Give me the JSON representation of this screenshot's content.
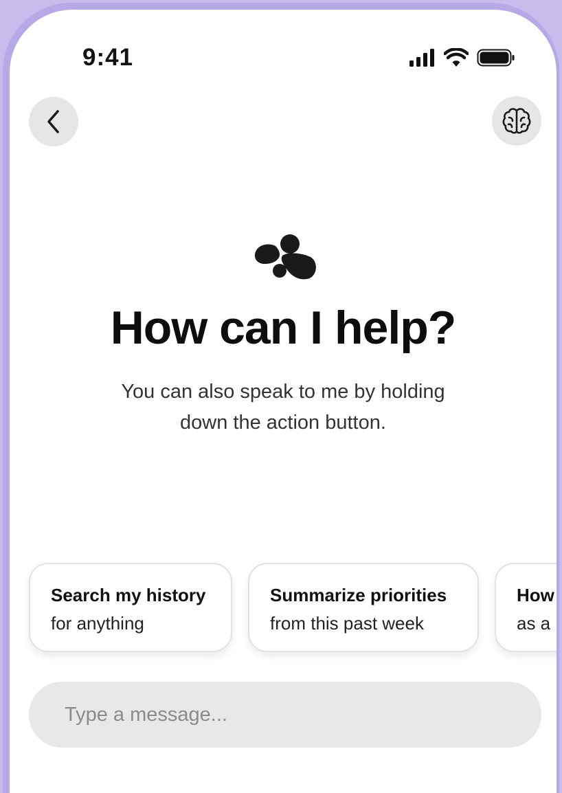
{
  "status_bar": {
    "time": "9:41",
    "icons": [
      "signal-icon",
      "wifi-icon",
      "battery-icon"
    ]
  },
  "header": {
    "back_icon": "chevron-left-icon",
    "memory_icon": "brain-icon"
  },
  "hero": {
    "logo_icon": "blob-logo-icon",
    "title": "How can I help?",
    "subtitle_line1": "You can also speak to me by holding",
    "subtitle_line2": "down the action button."
  },
  "suggestions": [
    {
      "title": "Search my history",
      "subtitle": "for anything"
    },
    {
      "title": "Summarize priorities",
      "subtitle": "from this past week"
    },
    {
      "title": "How",
      "subtitle": "as a"
    }
  ],
  "composer": {
    "placeholder": "Type a message...",
    "value": ""
  },
  "colors": {
    "frame": "#b7a9e6",
    "background": "#c7bcec",
    "button_bg": "#e6e6e6",
    "input_bg": "#e8e8e8"
  }
}
